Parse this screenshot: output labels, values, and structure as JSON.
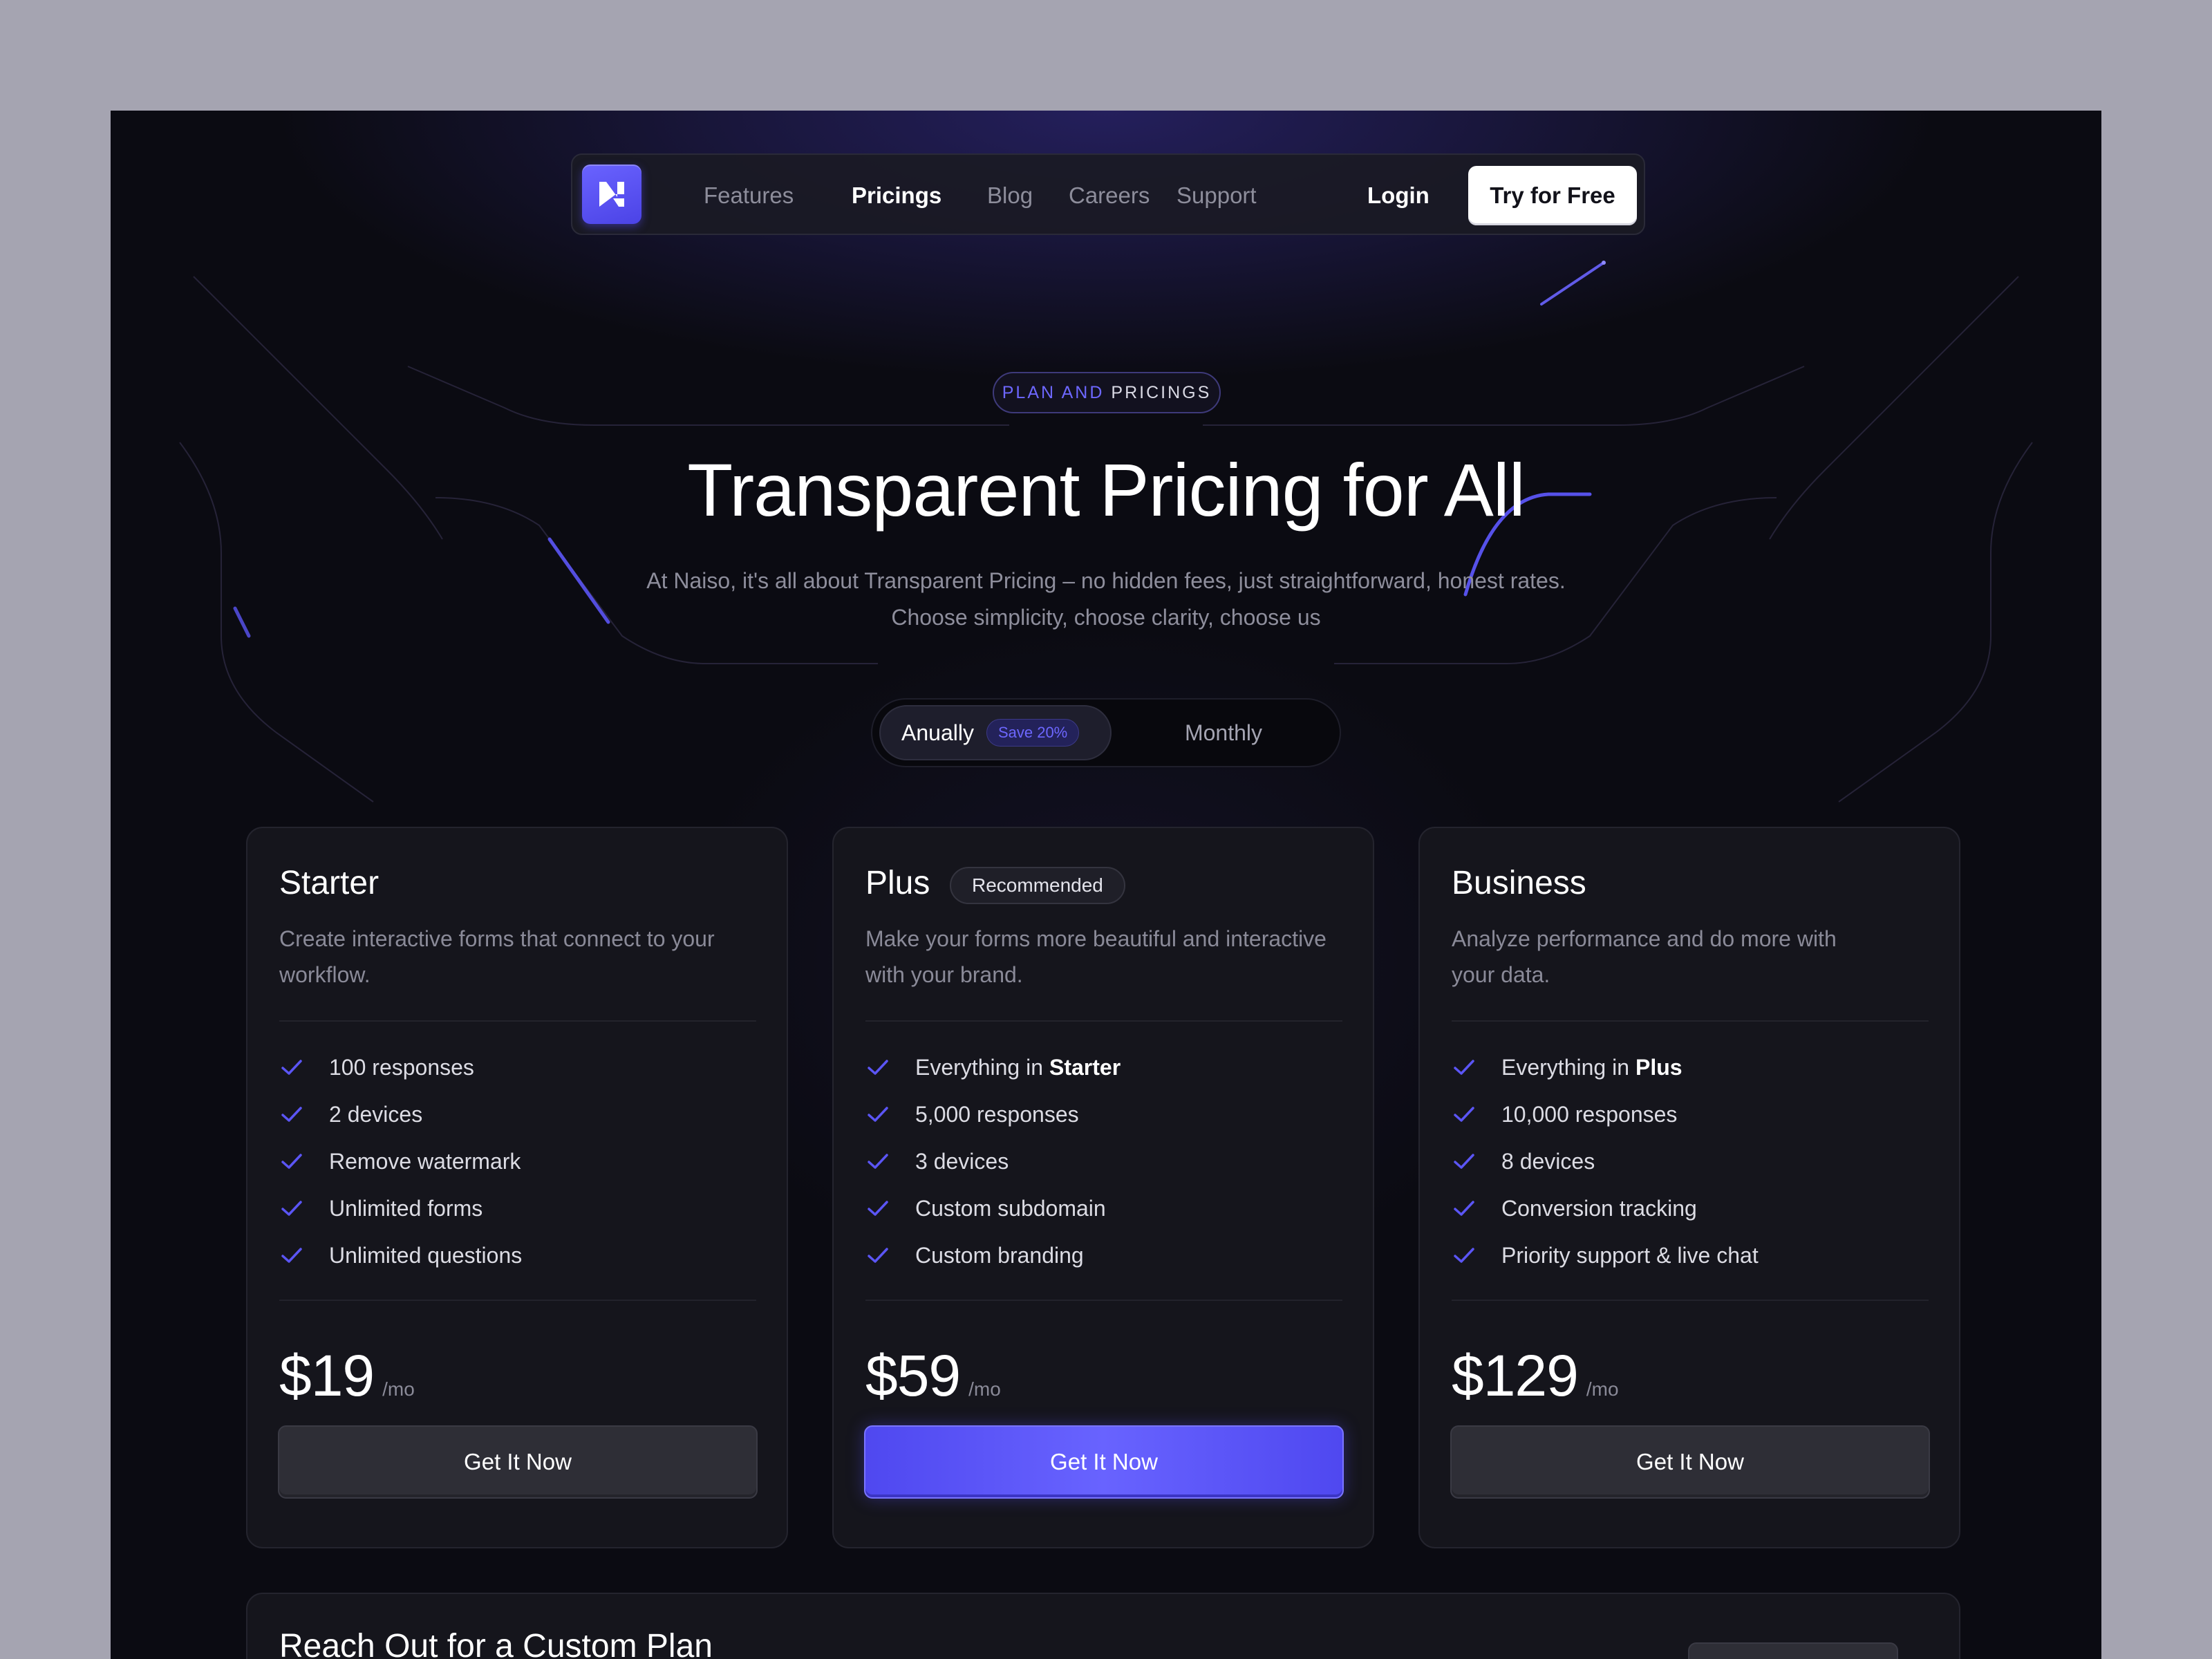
{
  "nav": {
    "links": [
      {
        "label": "Features",
        "active": false
      },
      {
        "label": "Pricings",
        "active": true
      },
      {
        "label": "Blog",
        "active": false
      },
      {
        "label": "Careers",
        "active": false
      },
      {
        "label": "Support",
        "active": false
      }
    ],
    "login_label": "Login",
    "cta_label": "Try for Free"
  },
  "hero": {
    "badge_accent": "PLAN AND",
    "badge_rest": "PRICINGS",
    "title": "Transparent Pricing for All",
    "subtitle_line1": "At Naiso, it's all about Transparent Pricing – no hidden fees, just straightforward, honest rates.",
    "subtitle_line2": "Choose simplicity, choose clarity, choose us"
  },
  "billing_toggle": {
    "annual_label": "Anually",
    "save_label": "Save 20%",
    "monthly_label": "Monthly",
    "selected": "annual"
  },
  "plans": [
    {
      "name": "Starter",
      "description": "Create interactive forms that connect to your workflow.",
      "features": [
        {
          "text": "100 responses"
        },
        {
          "text": "2 devices"
        },
        {
          "text": "Remove watermark"
        },
        {
          "text": "Unlimited forms"
        },
        {
          "text": "Unlimited questions"
        }
      ],
      "price": "$19",
      "period": "/mo",
      "cta": "Get It Now"
    },
    {
      "name": "Plus",
      "badge": "Recommended",
      "description": "Make your forms more beautiful and interactive with your brand.",
      "features": [
        {
          "text": "Everything in",
          "bold": "Starter"
        },
        {
          "text": "5,000 responses"
        },
        {
          "text": "3 devices"
        },
        {
          "text": "Custom subdomain"
        },
        {
          "text": "Custom branding"
        }
      ],
      "price": "$59",
      "period": "/mo",
      "cta": "Get It Now"
    },
    {
      "name": "Business",
      "description": "Analyze performance and do more with your data.",
      "features": [
        {
          "text": "Everything in",
          "bold": "Plus"
        },
        {
          "text": "10,000 responses"
        },
        {
          "text": "8 devices"
        },
        {
          "text": "Conversion tracking"
        },
        {
          "text": "Priority support & live chat"
        }
      ],
      "price": "$129",
      "period": "/mo",
      "cta": "Get It Now"
    }
  ],
  "custom_plan": {
    "title": "Reach Out for a Custom Plan"
  },
  "colors": {
    "accent": "#5b55f5",
    "background": "#0b0b12",
    "card": "#15151c",
    "outer": "#a5a4b1"
  },
  "icons": {
    "logo": "n-logo-icon",
    "feature_check": "check-icon"
  }
}
